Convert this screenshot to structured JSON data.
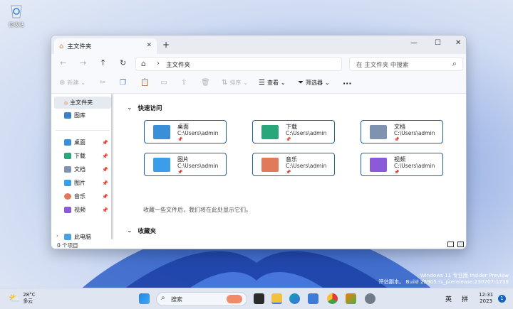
{
  "desktop": {
    "recycle_bin_label": "回收站"
  },
  "window": {
    "tab_title": "主文件夹",
    "address_path": "主文件夹",
    "search_placeholder": "在 主文件夹 中搜索",
    "toolbar": {
      "new_label": "新建",
      "sort_label": "排序",
      "view_label": "查看",
      "filter_label": "筛选器",
      "more_label": "···"
    },
    "sidebar": {
      "home": "主文件夹",
      "gallery": "图库",
      "pinned": [
        "桌面",
        "下载",
        "文档",
        "图片",
        "音乐",
        "视频"
      ],
      "this_pc": "此电脑"
    },
    "quick_access": {
      "heading": "快速访问",
      "items": [
        {
          "name": "桌面",
          "path": "C:\\Users\\admin",
          "color": "#3a8fd8"
        },
        {
          "name": "下载",
          "path": "C:\\Users\\admin",
          "color": "#2aa77a"
        },
        {
          "name": "文档",
          "path": "C:\\Users\\admin",
          "color": "#7f93b1"
        },
        {
          "name": "图片",
          "path": "C:\\Users\\admin",
          "color": "#3b9ee8"
        },
        {
          "name": "音乐",
          "path": "C:\\Users\\admin",
          "color": "#e07a5a"
        },
        {
          "name": "视频",
          "path": "C:\\Users\\admin",
          "color": "#8b5ad8"
        }
      ]
    },
    "favorites": {
      "heading": "收藏夹",
      "hint": "收藏一些文件后，我们将在此处显示它们。"
    },
    "status": "0 个项目"
  },
  "watermark": {
    "line1": "Windows 11 专业版 Insider Preview",
    "line2": "评估副本。 Build 25905.rs_prerelease.230707-1739"
  },
  "taskbar": {
    "temperature": "28°C",
    "weather_desc": "多云",
    "search_placeholder": "搜索",
    "ime_lang": "英",
    "ime_mode": "拼",
    "time": "12:31",
    "date": "2023",
    "notification_count": "1"
  }
}
